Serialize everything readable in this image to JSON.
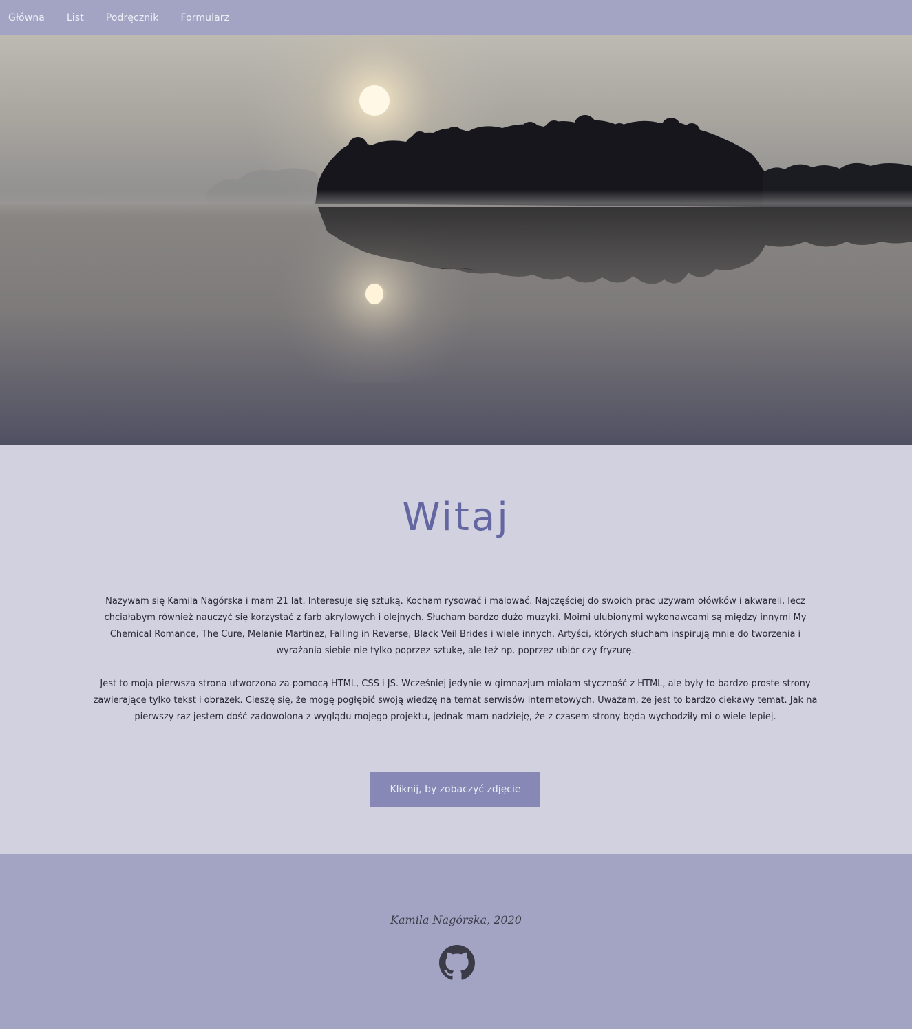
{
  "nav": {
    "items": [
      {
        "label": "Główna"
      },
      {
        "label": "List"
      },
      {
        "label": "Podręcznik"
      },
      {
        "label": "Formularz"
      }
    ]
  },
  "hero": {
    "image": "misty-lake-sunrise-photo"
  },
  "main": {
    "title": "Witaj",
    "paragraph_1": "Nazywam się Kamila Nagórska i mam 21 lat. Interesuje się sztuką. Kocham rysować i malować. Najczęściej do swoich prac używam ołówków i akwareli, lecz chciałabym również nauczyć się korzystać z farb akrylowych i olejnych. Słucham bardzo dużo muzyki. Moimi ulubionymi wykonawcami są między innymi My Chemical Romance, The Cure, Melanie Martinez, Falling in Reverse, Black Veil Brides i wiele innych. Artyści, których słucham inspirują mnie do tworzenia i wyrażania siebie nie tylko poprzez sztukę, ale też np. poprzez ubiór czy fryzurę.",
    "paragraph_2": "Jest to moja pierwsza strona utworzona za pomocą HTML, CSS i JS. Wcześniej jedynie w gimnazjum miałam styczność z HTML, ale były to bardzo proste strony zawierające tylko tekst i obrazek. Cieszę się, że mogę pogłębić swoją wiedzę na temat serwisów internetowych. Uważam, że jest to bardzo ciekawy temat. Jak na pierwszy raz jestem dość zadowolona z wyglądu mojego projektu, jednak mam nadzieję, że z czasem strony będą wychodziły mi o wiele lepiej.",
    "button_label": "Kliknij, by zobaczyć zdjęcie"
  },
  "footer": {
    "signature": "Kamila Nagórska, 2020",
    "icon": "github-icon"
  },
  "colors": {
    "nav_bg": "#a3a4c4",
    "main_bg": "#d1d1e0",
    "title": "#6366a0",
    "button_bg": "#8788b5",
    "footer_bg": "#a3a4c4"
  }
}
